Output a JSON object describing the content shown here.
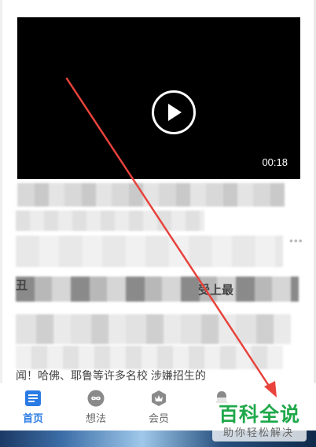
{
  "video": {
    "duration": "00:18"
  },
  "feed": {
    "fragment_1": "丑",
    "fragment_2": "受上最",
    "fragment_3": "闻！哈佛、耶鲁等许多名校 涉嫌招生的",
    "more": "•••"
  },
  "tabbar": {
    "tabs": [
      {
        "label": "首页",
        "active": true
      },
      {
        "label": "想法",
        "active": false
      },
      {
        "label": "会员",
        "active": false
      },
      {
        "label": "",
        "active": false
      }
    ]
  },
  "watermark": {
    "title": "百科全说",
    "subtitle": "助你轻松解决"
  },
  "colors": {
    "accent": "#2a7be4",
    "arrow": "#e8423b",
    "watermark": "#1fa84a"
  }
}
